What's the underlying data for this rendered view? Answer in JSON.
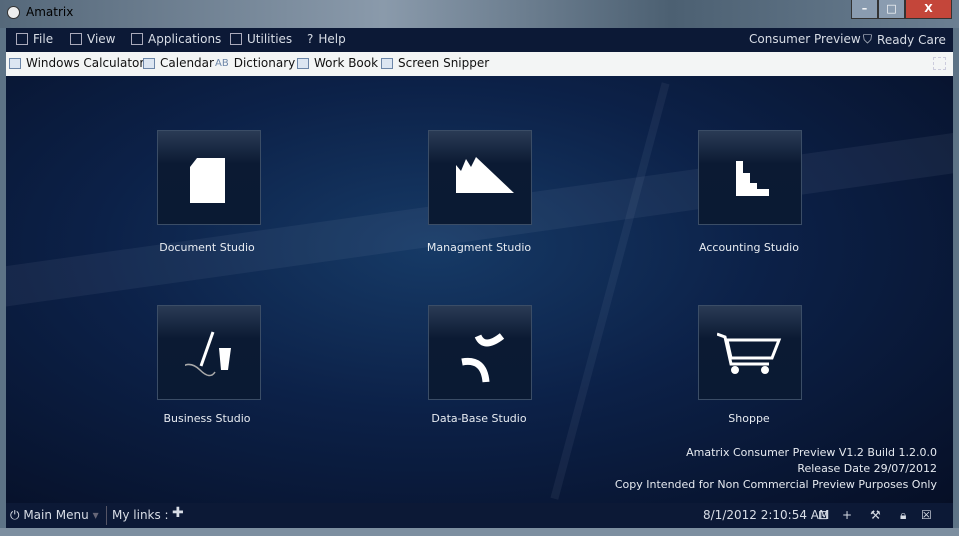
{
  "window": {
    "title": "Amatrix",
    "minimize": "–",
    "maximize": "□",
    "close": "X"
  },
  "menu": {
    "items": [
      "File",
      "View",
      "Applications",
      "Utilities",
      "Help"
    ],
    "right": [
      "Consumer Preview",
      "Ready Care"
    ]
  },
  "toolbar": {
    "items": [
      "Windows Calculator",
      "Calendar",
      "Dictionary",
      "Work Book",
      "Screen Snipper"
    ]
  },
  "tiles": [
    "Document Studio",
    "Managment Studio",
    "Accounting Studio",
    "Business Studio",
    "Data-Base Studio",
    "Shoppe"
  ],
  "version": {
    "line1": "Amatrix Consumer Preview V1.2 Build 1.2.0.0",
    "line2": "Release Date 29/07/2012",
    "line3": "Copy Intended for Non Commercial Preview Purposes Only"
  },
  "status": {
    "main_menu": "Main Menu",
    "my_links": "My links :",
    "datetime": "8/1/2012 2:10:54 AM"
  }
}
